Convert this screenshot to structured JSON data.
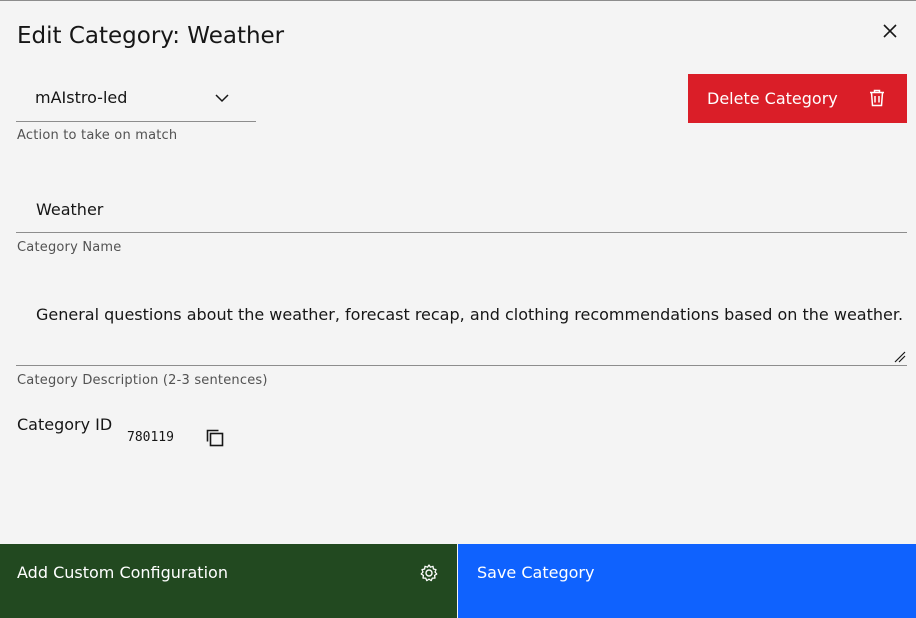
{
  "modal": {
    "title": "Edit Category: Weather"
  },
  "action_select": {
    "value": "mAIstro-led",
    "helper": "Action to take on match"
  },
  "delete_button": {
    "label": "Delete Category"
  },
  "name_field": {
    "value": "Weather",
    "helper": "Category Name"
  },
  "description_field": {
    "value": "General questions about the weather, forecast recap, and clothing recommendations based on the weather.",
    "helper": "Category Description (2-3 sentences)"
  },
  "category_id": {
    "label": "Category ID",
    "value": "780119"
  },
  "footer": {
    "secondary_label": "Add Custom Configuration",
    "primary_label": "Save Category"
  },
  "icons": {
    "close": "close-icon",
    "chevron": "chevron-down-icon",
    "trash": "trash-icon",
    "copy": "copy-icon",
    "gear": "gear-icon",
    "resize": "resize-handle-icon"
  },
  "colors": {
    "danger": "#da1e28",
    "primary": "#0f62fe",
    "secondary": "#224920",
    "background": "#f4f4f4"
  }
}
